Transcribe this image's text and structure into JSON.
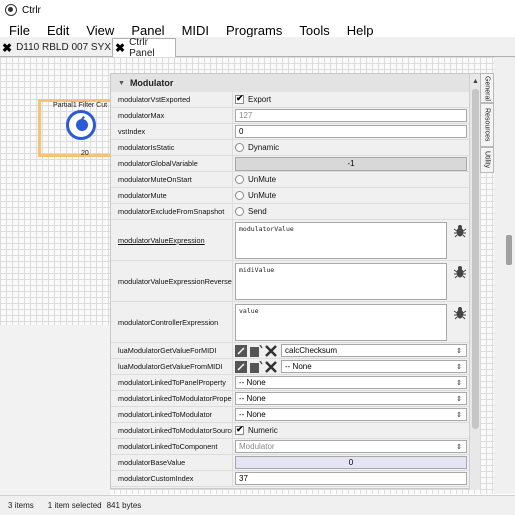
{
  "window": {
    "title": "Ctrlr"
  },
  "menu": [
    "File",
    "Edit",
    "View",
    "Panel",
    "MIDI",
    "Programs",
    "Tools",
    "Help"
  ],
  "tabs": [
    {
      "label": "D110 RBLD 007 SYX",
      "active": false
    },
    {
      "label": "Ctrlr Panel",
      "active": true
    }
  ],
  "canvas": {
    "component_label": "Partial1 Filter Cut",
    "component_value": "20"
  },
  "panel": {
    "header": "Modulator",
    "side_tabs": [
      "General",
      "Resources",
      "Utility"
    ],
    "rows": {
      "vst_exported": {
        "label": "modulatorVstExported",
        "value": "Export",
        "checked": true
      },
      "max": {
        "label": "modulatorMax",
        "value": "127"
      },
      "vst_index": {
        "label": "vstIndex",
        "value": "0"
      },
      "is_static": {
        "label": "modulatorIsStatic",
        "value": "Dynamic"
      },
      "global_variable": {
        "label": "modulatorGlobalVariable",
        "value": "-1"
      },
      "mute_on_start": {
        "label": "modulatorMuteOnStart",
        "value": "UnMute"
      },
      "mute": {
        "label": "modulatorMute",
        "value": "UnMute"
      },
      "exclude_snapshot": {
        "label": "modulatorExcludeFromSnapshot",
        "value": "Send"
      },
      "value_expression": {
        "label": "modulatorValueExpression",
        "value": "modulatorValue"
      },
      "value_expression_reverse": {
        "label": "modulatorValueExpressionReverse",
        "value": "midiValue"
      },
      "controller_expression": {
        "label": "modulatorControllerExpression",
        "value": "value"
      },
      "lua_for_midi": {
        "label": "luaModulatorGetValueForMIDI",
        "value": "calcChecksum"
      },
      "lua_from_midi": {
        "label": "luaModulatorGetValueFromMIDI",
        "value": "-- None"
      },
      "linked_panel_property": {
        "label": "modulatorLinkedToPanelProperty",
        "value": "-- None"
      },
      "linked_modulator_property": {
        "label": "modulatorLinkedToModulatorProperty",
        "value": "-- None"
      },
      "linked_modulator": {
        "label": "modulatorLinkedToModulator",
        "value": "-- None"
      },
      "linked_modulator_source": {
        "label": "modulatorLinkedToModulatorSource",
        "value": "Numeric",
        "checked": true
      },
      "linked_component": {
        "label": "modulatorLinkedToComponent",
        "value": "Modulator"
      },
      "base_value": {
        "label": "modulatorBaseValue",
        "value": "0"
      },
      "custom_index": {
        "label": "modulatorCustomIndex",
        "value": "37"
      }
    }
  },
  "status": {
    "items": "3 items",
    "selected": "1 item selected",
    "size": "841 bytes"
  },
  "colors": {
    "knob": "#2b5bd7",
    "component_border": "#f6c275",
    "grid": "#dcdcdc"
  }
}
